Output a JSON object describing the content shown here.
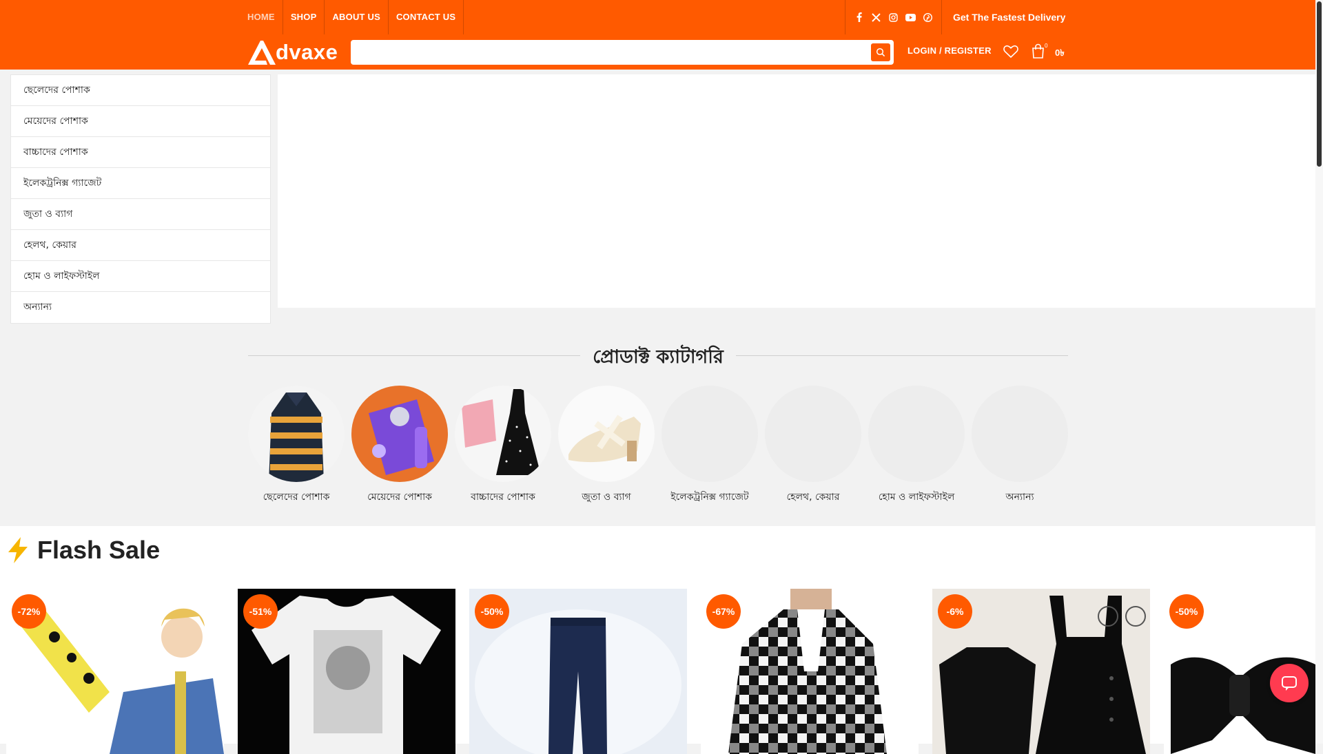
{
  "colors": {
    "brand": "#ff5a00",
    "badge": "#ff5a00",
    "chat": "#ff3b50"
  },
  "topnav": [
    {
      "label": "HOME",
      "active": true
    },
    {
      "label": "SHOP"
    },
    {
      "label": "ABOUT US"
    },
    {
      "label": "CONTACT US"
    }
  ],
  "social_icons": [
    "facebook-icon",
    "x-icon",
    "instagram-icon",
    "youtube-icon",
    "pinterest-icon"
  ],
  "delivery_text": "Get The Fastest Delivery",
  "logo": {
    "text": "dvaxe",
    "initial": "A"
  },
  "search": {
    "placeholder": ""
  },
  "account": {
    "login_label": "LOGIN / REGISTER",
    "cart_count": "0",
    "cart_total": "0৳"
  },
  "sidebar": {
    "items": [
      "ছেলেদের পোশাক",
      "মেয়েদের পোশাক",
      "বাচ্চাদের পোশাক",
      "ইলেকট্রনিক্স গ্যাজেট",
      "জুতা ও ব্যাগ",
      "হেলথ, কেয়ার",
      "হোম ও লাইফস্টাইল",
      "অন্যান্য"
    ]
  },
  "categories": {
    "title": "প্রোডাক্ট ক্যাটাগরি",
    "items": [
      "ছেলেদের পোশাক",
      "মেয়েদের পোশাক",
      "বাচ্চাদের পোশাক",
      "জুতা ও ব্যাগ",
      "ইলেকট্রনিক্স গ্যাজেট",
      "হেলথ, কেয়ার",
      "হোম ও লাইফস্টাইল",
      "অন্যান্য"
    ]
  },
  "flash_sale": {
    "title": "Flash Sale",
    "icon": "lightning-icon",
    "products": [
      {
        "discount": "-72%"
      },
      {
        "discount": "-51%"
      },
      {
        "discount": "-50%"
      },
      {
        "discount": "-67%"
      },
      {
        "discount": "-6%"
      },
      {
        "discount": "-50%"
      }
    ]
  }
}
